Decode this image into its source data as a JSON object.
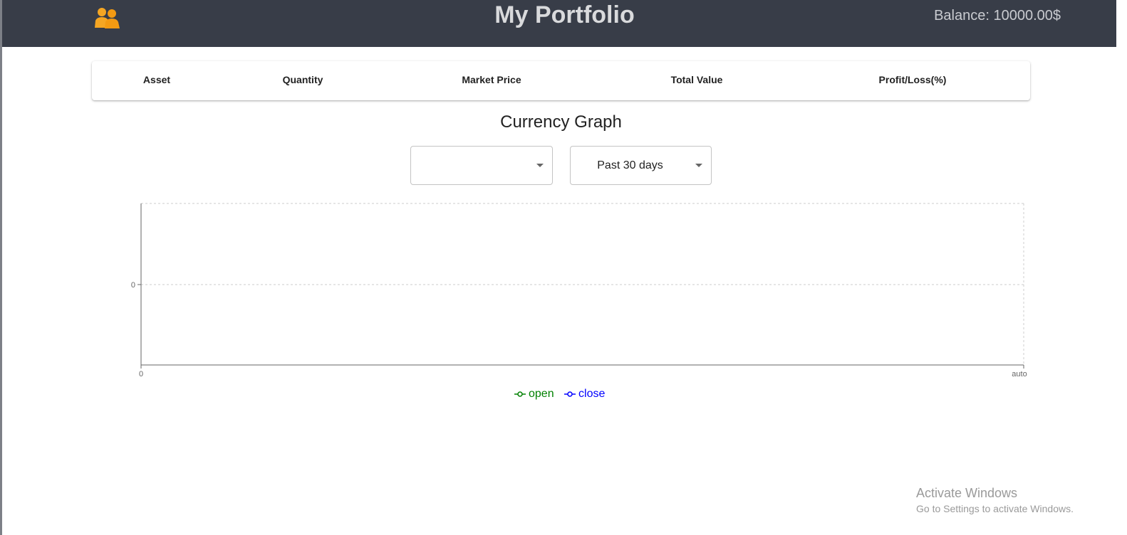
{
  "header": {
    "title": "My Portfolio",
    "balance": "Balance: 10000.00$",
    "logo_icon": "users-icon",
    "logo_color": "#f5a623",
    "background": "#383d48"
  },
  "portfolio_table": {
    "columns": [
      "Asset",
      "Quantity",
      "Market Price",
      "Total Value",
      "Profit/Loss(%)"
    ],
    "rows": []
  },
  "graph": {
    "title": "Currency Graph",
    "currency_select": {
      "value": ""
    },
    "period_select": {
      "value": "Past 30 days"
    }
  },
  "chart_data": {
    "type": "line",
    "series": [
      {
        "name": "open",
        "color": "#008000",
        "values": []
      },
      {
        "name": "close",
        "color": "#0000ff",
        "values": []
      }
    ],
    "x_ticks": [
      "0",
      "auto"
    ],
    "y_ticks": [
      "0"
    ],
    "grid": true,
    "legend_position": "bottom-center"
  },
  "watermark": {
    "title": "Activate Windows",
    "subtitle": "Go to Settings to activate Windows."
  }
}
